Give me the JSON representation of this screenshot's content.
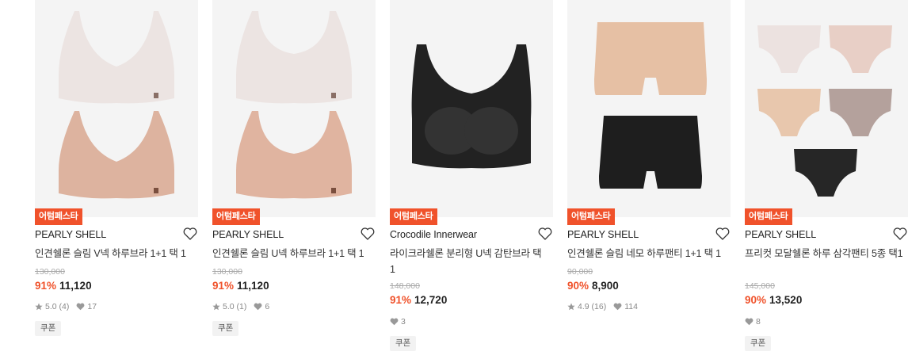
{
  "products": [
    {
      "badge": "어텀페스타",
      "brand": "PEARLY SHELL",
      "title": "인견쉘론 슬림 V넥 하루브라 1+1 택 1",
      "original_price": "130,000",
      "discount": "91%",
      "price": "11,120",
      "rating": "5.0",
      "reviews": "(4)",
      "likes": "17",
      "coupon": "쿠폰"
    },
    {
      "badge": "어텀페스타",
      "brand": "PEARLY SHELL",
      "title": "인견쉘론 슬림 U넥 하루브라 1+1 택 1",
      "original_price": "130,000",
      "discount": "91%",
      "price": "11,120",
      "rating": "5.0",
      "reviews": "(1)",
      "likes": "6",
      "coupon": "쿠폰"
    },
    {
      "badge": "어텀페스타",
      "brand": "Crocodile Innerwear",
      "title": "라이크라쉘론 분리형 U넥 감탄브라 택 1",
      "original_price": "148,000",
      "discount": "91%",
      "price": "12,720",
      "likes": "3",
      "coupon": "쿠폰"
    },
    {
      "badge": "어텀페스타",
      "brand": "PEARLY SHELL",
      "title": "인견쉘론 슬림 네모 하루팬티 1+1 택 1",
      "original_price": "90,000",
      "discount": "90%",
      "price": "8,900",
      "rating": "4.9",
      "reviews": "(16)",
      "likes": "114"
    },
    {
      "badge": "어텀페스타",
      "brand": "PEARLY SHELL",
      "title": "프리컷 모달쉘론 하루 삼각팬티 5종 택1",
      "original_price": "145,000",
      "discount": "90%",
      "price": "13,520",
      "likes": "8",
      "coupon": "쿠폰"
    }
  ],
  "icons": {
    "heart": "heart-outline-icon",
    "star": "star-icon",
    "like": "heart-filled-icon"
  },
  "colors": {
    "accent": "#f0522b",
    "muted": "#aaaaaa",
    "meta": "#888888",
    "coupon_bg": "#f2f2f2"
  }
}
